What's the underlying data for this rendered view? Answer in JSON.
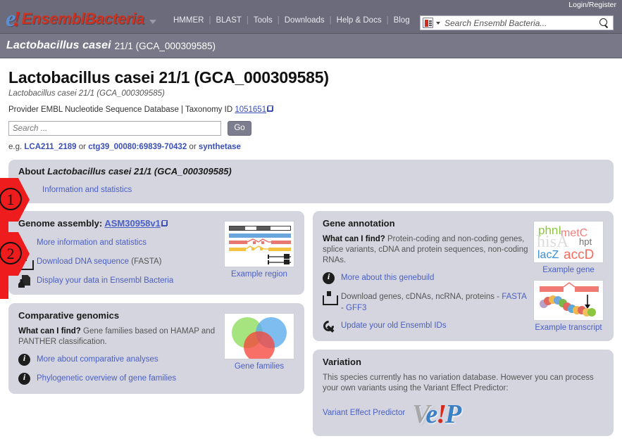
{
  "header": {
    "login_label": "Login/Register",
    "logo": {
      "e": "e",
      "bang": "!",
      "ensembl": "Ensembl",
      "bacteria": "Bacteria"
    },
    "nav": [
      {
        "label": "HMMER"
      },
      {
        "label": "BLAST"
      },
      {
        "label": "Tools"
      },
      {
        "label": "Downloads"
      },
      {
        "label": "Help & Docs"
      },
      {
        "label": "Blog"
      }
    ],
    "search": {
      "placeholder": "Search Ensembl Bacteria..."
    }
  },
  "species_bar": {
    "name": "Lactobacillus casei",
    "strain": "21/1 (GCA_000309585)"
  },
  "page": {
    "title": "Lactobacillus casei 21/1 (GCA_000309585)",
    "subtitle": "Lactobacillus casei 21/1 (GCA_000309585)",
    "provider_prefix": "Provider EMBL Nucleotide Sequence Database | Taxonomy ID ",
    "taxonomy_id": "1051651",
    "search_placeholder": "Search ...",
    "go_label": "Go",
    "examples_prefix": "e.g. ",
    "example_1": "LCA211_2189",
    "example_sep1": " or ",
    "example_2": "ctg39_00080:69839-70432",
    "example_sep2": " or ",
    "example_3": "synthetase"
  },
  "about_panel": {
    "heading_prefix": "About ",
    "heading_species": "Lactobacillus casei 21/1 (GCA_000309585)",
    "link": "Information and statistics"
  },
  "assembly_panel": {
    "heading_prefix": "Genome assembly: ",
    "assembly_name": "ASM30958v1",
    "links": [
      {
        "label": "More information and statistics",
        "icon": "none"
      },
      {
        "label": "Download DNA sequence",
        "suffix": " (FASTA)",
        "icon": "download-icon"
      },
      {
        "label": "Display your data in Ensembl Bacteria",
        "icon": "upload-icon"
      }
    ],
    "thumb_caption": "Example region"
  },
  "comparative_panel": {
    "heading": "Comparative genomics",
    "what_label": "What can I find?",
    "what_text": " Gene families based on HAMAP and PANTHER classification.",
    "links": [
      {
        "label": "More about comparative analyses",
        "icon": "info-icon"
      },
      {
        "label": "Phylogenetic overview of gene families",
        "icon": "info-icon"
      }
    ],
    "thumb_caption": "Gene families"
  },
  "gene_panel": {
    "heading": "Gene annotation",
    "what_label": "What can I find?",
    "what_text": " Protein-coding and non-coding genes, splice variants, cDNA and protein sequences, non-coding RNAs.",
    "link_genebuild": "More about this genebuild",
    "download_text": "Download genes, cDNAs, ncRNA, proteins - ",
    "download_fasta": "FASTA",
    "download_dash": " - ",
    "download_gff3": "GFF3",
    "link_update": "Update your old Ensembl IDs",
    "gene_thumb_caption": "Example gene",
    "transcript_thumb_caption": "Example transcript",
    "word_cloud": [
      {
        "text": "phnI",
        "color": "#8cc63f"
      },
      {
        "text": "metC",
        "color": "#f08080"
      },
      {
        "text": "hisA",
        "color": "#d9d9d9"
      },
      {
        "text": "hpt",
        "color": "#6e6e6e"
      },
      {
        "text": "lacZ",
        "color": "#3b8fd4"
      },
      {
        "text": "accD",
        "color": "#f26d5b"
      }
    ]
  },
  "variation_panel": {
    "heading": "Variation",
    "text": "This species currently has no variation database. However you can process your own variants using the Variant Effect Predictor:",
    "link": "Variant Effect Predictor",
    "vep_logo": {
      "v": "V",
      "e": "e",
      "bang": "!",
      "p": "P"
    }
  },
  "markers": [
    {
      "number": "1"
    },
    {
      "number": "2"
    }
  ],
  "colors": {
    "masthead": "#6b6b7b",
    "species_bar": "#787888",
    "panel_bg": "#d5d5df",
    "link": "#4a5fc4",
    "marker_red": "#ee1c1c",
    "logo_red": "#cc3322",
    "logo_blue": "#5a8fd6"
  }
}
